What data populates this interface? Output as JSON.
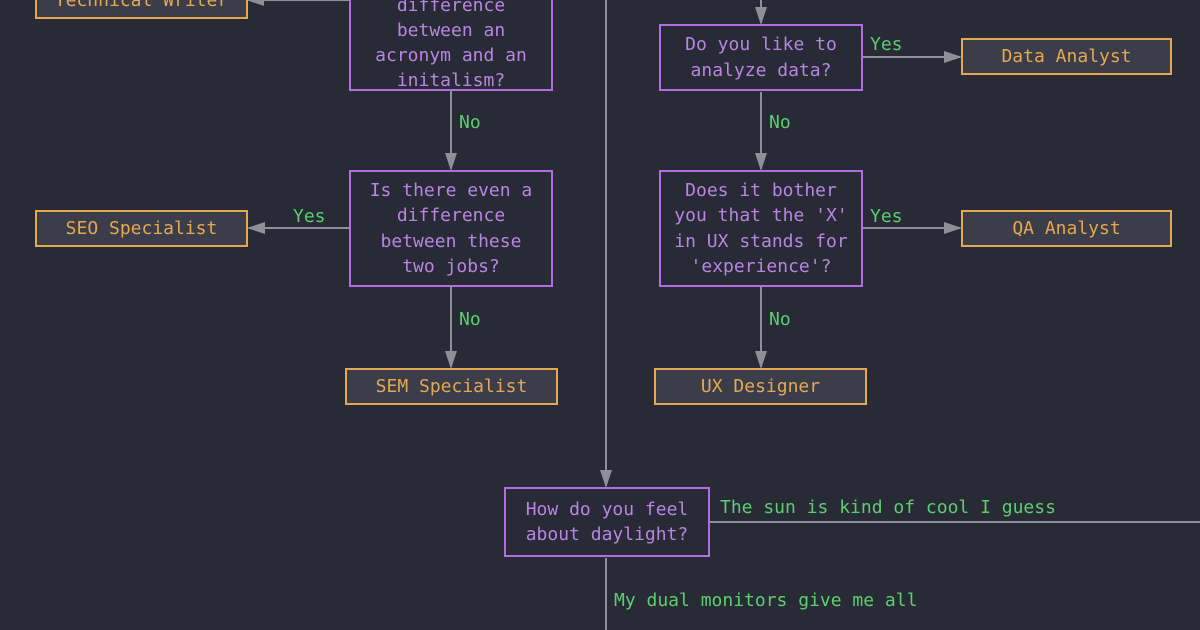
{
  "labels": {
    "yes": "Yes",
    "no": "No"
  },
  "edges": {
    "daylight_sun": "The sun is kind of cool I guess",
    "daylight_monitors": "My dual monitors give me all"
  },
  "decisions": {
    "acronym": "Do you know the difference between an acronym and an initalism?",
    "two_jobs": "Is there even a difference between these two jobs?",
    "analyze": "Do you like to analyze data?",
    "ux_x": "Does it bother you that the 'X' in UX stands for 'experience'?",
    "daylight": "How do you feel about daylight?"
  },
  "results": {
    "tech_writer": "Technical Writer",
    "seo": "SEO Specialist",
    "sem": "SEM Specialist",
    "data_analyst": "Data Analyst",
    "qa": "QA Analyst",
    "ux": "UX Designer"
  }
}
